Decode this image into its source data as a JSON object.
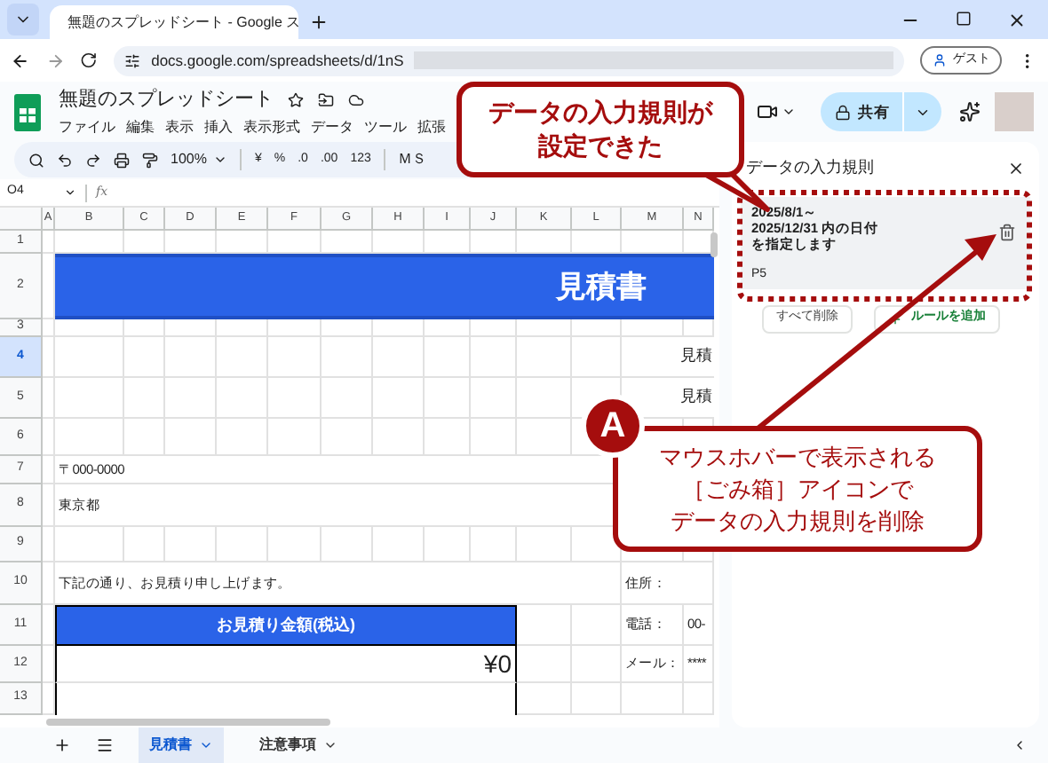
{
  "browser": {
    "tab_title": "無題のスプレッドシート - Google ス",
    "url": "docs.google.com/spreadsheets/d/1nS",
    "profile": "ゲスト"
  },
  "app": {
    "title": "無題のスプレッドシート",
    "menus": [
      "ファイル",
      "編集",
      "表示",
      "挿入",
      "表示形式",
      "データ",
      "ツール",
      "拡張"
    ],
    "share": "共有"
  },
  "toolbar": {
    "zoom": "100%",
    "items": [
      "¥",
      "%",
      ".0",
      ".00",
      "123"
    ],
    "font": "ＭＳ"
  },
  "formula_bar": {
    "name_box": "O4",
    "fx": "fx"
  },
  "sheet": {
    "columns": [
      "A",
      "B",
      "C",
      "D",
      "E",
      "F",
      "G",
      "H",
      "I",
      "J",
      "K",
      "L",
      "M",
      "N"
    ],
    "rows": [
      {
        "number": "1",
        "selected": false,
        "cells": []
      },
      {
        "number": "2",
        "selected": false,
        "cells": [
          "",
          "",
          "",
          "",
          "",
          "",
          "",
          "",
          "",
          "",
          "",
          "見積書"
        ]
      },
      {
        "number": "3",
        "selected": false,
        "cells": []
      },
      {
        "number": "4",
        "selected": true,
        "cells": [
          "",
          "",
          "",
          "",
          "",
          "",
          "",
          "",
          "",
          "",
          "",
          "",
          "",
          "見積"
        ]
      },
      {
        "number": "5",
        "selected": false,
        "cells": [
          "",
          "",
          "",
          "",
          "",
          "",
          "",
          "",
          "",
          "",
          "",
          "",
          "",
          "見積"
        ]
      },
      {
        "number": "6",
        "selected": false,
        "cells": []
      },
      {
        "number": "7",
        "selected": false,
        "cells": [
          "",
          "〒000-0000"
        ]
      },
      {
        "number": "8",
        "selected": false,
        "cells": [
          "",
          "東京都"
        ]
      },
      {
        "number": "9",
        "selected": false,
        "cells": []
      },
      {
        "number": "10",
        "selected": false,
        "cells": [
          "",
          "下記の通り、お見積り申し上げます。",
          "",
          "",
          "",
          "",
          "",
          "",
          "",
          "",
          "",
          "",
          "住所："
        ]
      },
      {
        "number": "11",
        "selected": false,
        "cells": [
          "",
          "",
          "",
          "",
          "",
          "お見積り金額(税込)",
          "",
          "",
          "",
          "",
          "",
          "",
          "電話：",
          "00-"
        ]
      },
      {
        "number": "12",
        "selected": false,
        "cells": [
          "",
          "",
          "",
          "",
          "",
          "",
          "",
          "",
          "",
          "¥0",
          "",
          "",
          "メール：",
          "****"
        ]
      },
      {
        "number": "13",
        "selected": false,
        "cells": []
      }
    ]
  },
  "sheet_tabs": [
    {
      "label": "見積書",
      "selected": true
    },
    {
      "label": "注意事項",
      "selected": false
    }
  ],
  "panel": {
    "title": "データの入力規則",
    "rule": {
      "lines": [
        "2025/8/1～",
        "2025/12/31 内の日付",
        "を指定します"
      ],
      "range": "P5"
    },
    "buttons": [
      "すべて削除",
      "ルールを追加"
    ]
  },
  "callouts": [
    {
      "lines": [
        "データの入力規則が",
        "設定できた"
      ]
    },
    {
      "badge": "A",
      "lines": [
        "マウスホバーで表示される",
        "［ごみ箱］アイコンで",
        "データの入力規則を削除"
      ]
    }
  ]
}
